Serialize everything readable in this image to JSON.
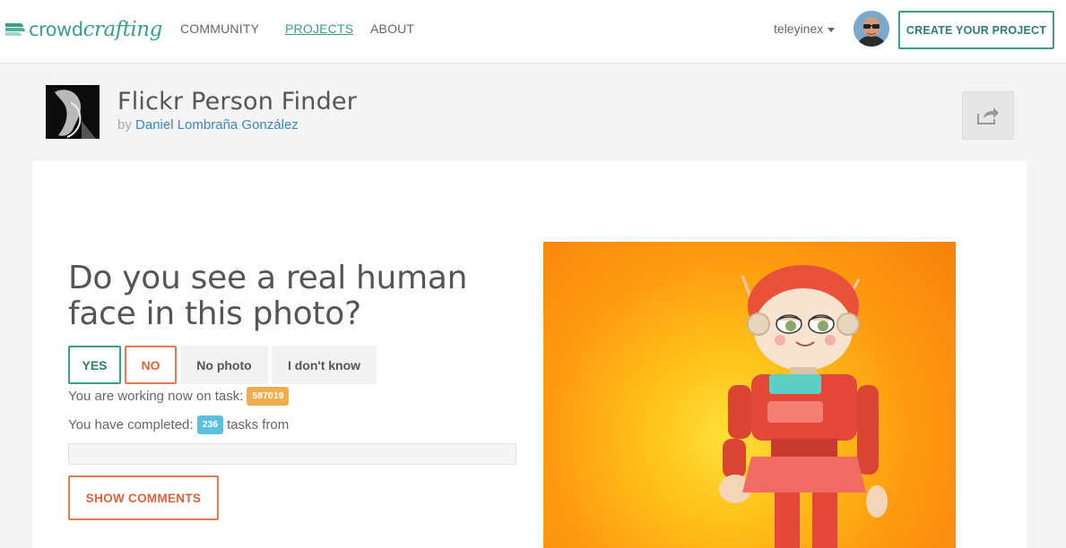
{
  "navbar": {
    "logo": {
      "part1": "crowd",
      "part2": "crafting"
    },
    "links": [
      {
        "label": "COMMUNITY"
      },
      {
        "label": "PROJECTS"
      },
      {
        "label": "ABOUT"
      }
    ],
    "username": "teleyinex",
    "create_button": "CREATE YOUR PROJECT"
  },
  "project": {
    "title": "Flickr Person Finder",
    "by_prefix": "by",
    "author": "Daniel Lombraña González"
  },
  "task": {
    "question": "Do you see a real human face in this photo?",
    "answers": {
      "yes": "YES",
      "no": "NO",
      "no_photo": "No photo",
      "dont_know": "I don't know"
    },
    "working_prefix": "You are working now on task:",
    "task_id": "587019",
    "completed_prefix": "You have completed:",
    "completed_count": "236",
    "completed_suffix": "tasks from",
    "show_comments": "SHOW COMMENTS"
  },
  "colors": {
    "accent": "#3a9e8b",
    "secondary": "#e07b55",
    "badge_orange": "#f0ad4e",
    "badge_blue": "#5bc0de"
  }
}
